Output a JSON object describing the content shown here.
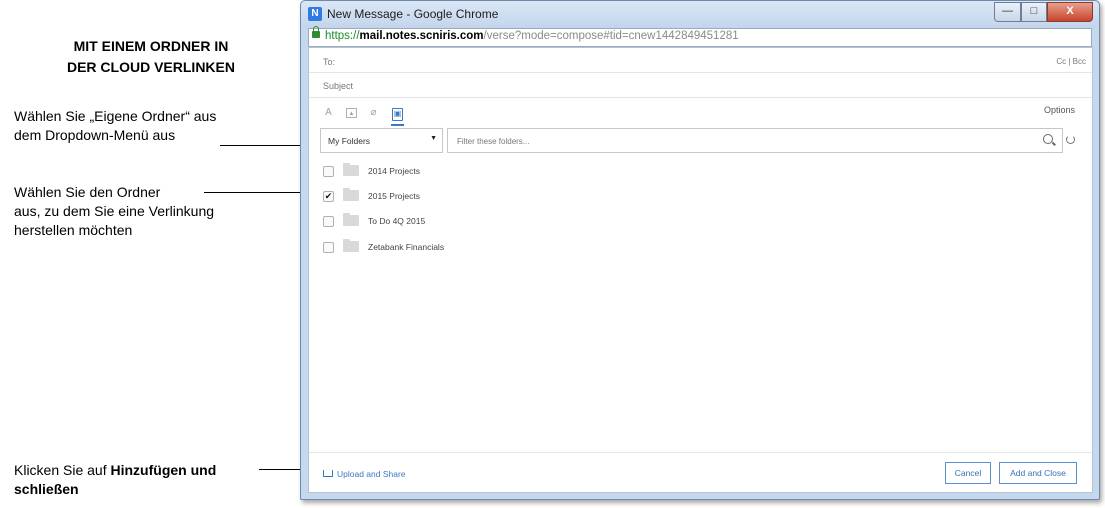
{
  "annotations": {
    "title_line1": "MIT EINEM ORDNER IN",
    "title_line2": "DER CLOUD VERLINKEN",
    "step1_line1": "Wählen Sie „Eigene Ordner“ aus",
    "step1_line2": "dem Dropdown-Menü aus",
    "step2_line1": "Wählen Sie den Ordner",
    "step2_line2": "aus, zu dem Sie eine Verlinkung",
    "step2_line3": "herstellen möchten",
    "step3_prefix": "Klicken Sie auf ",
    "step3_bold1": "Hinzufügen und",
    "step3_bold2": "schließen"
  },
  "window": {
    "title": "New Message - Google Chrome",
    "app_icon": "N",
    "controls": {
      "minimize": "—",
      "maximize": "□",
      "close": "X"
    }
  },
  "urlbar": {
    "scheme": "https://",
    "host": "mail.notes.scniris.com",
    "path": "/verse?mode=compose#tid=cnew1442849451281"
  },
  "compose": {
    "to_label": "To:",
    "cc_bcc": "Cc | Bcc",
    "subject_label": "Subject",
    "options_label": "Options",
    "toolbar_icons": [
      "text-format-icon",
      "image-icon",
      "attach-link-icon",
      "folder-link-icon"
    ]
  },
  "folder_picker": {
    "dropdown_value": "My Folders",
    "dropdown_caret": "▼",
    "filter_placeholder": "Filter these folders...",
    "folders": [
      {
        "name": "2014 Projects",
        "checked": false,
        "check": ""
      },
      {
        "name": "2015 Projects",
        "checked": true,
        "check": "✔"
      },
      {
        "name": "To Do 4Q 2015",
        "checked": false,
        "check": ""
      },
      {
        "name": "Zetabank Financials",
        "checked": false,
        "check": ""
      }
    ]
  },
  "footer": {
    "upload_label": "Upload and Share",
    "cancel_label": "Cancel",
    "add_close_label": "Add and Close"
  },
  "colors": {
    "accent": "#3a78c2",
    "window_frame": "#c6d8ee",
    "close_button": "#c8442b"
  }
}
